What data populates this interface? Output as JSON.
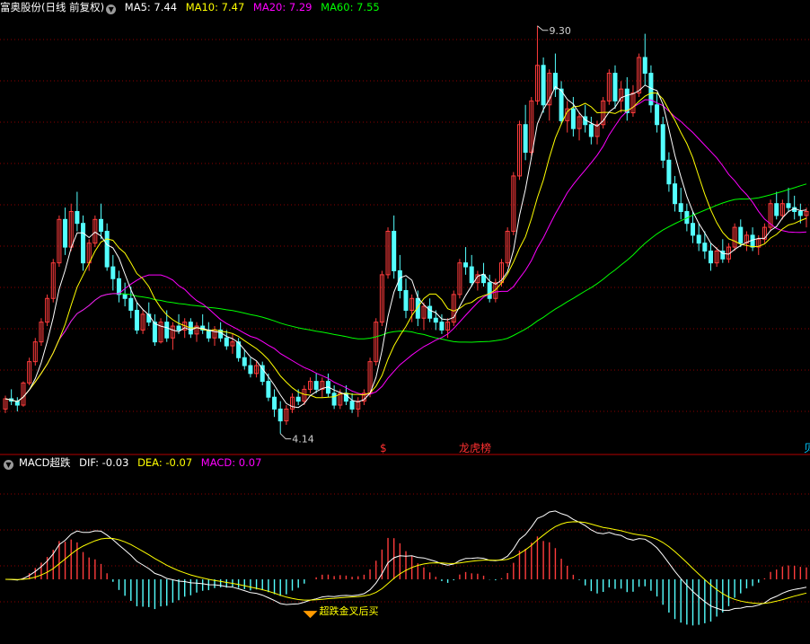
{
  "main_panel": {
    "title": "富奥股份(日线 前复权)",
    "indicators": [
      {
        "label": "MA5: 7.44",
        "color": "#ffffff"
      },
      {
        "label": "MA10: 7.47",
        "color": "#ffff00"
      },
      {
        "label": "MA20: 7.29",
        "color": "#ff00ff"
      },
      {
        "label": "MA60: 7.55",
        "color": "#00ff00"
      }
    ],
    "high_label": "9.30",
    "low_label": "4.14",
    "markers": [
      {
        "text": "$",
        "color": "#ff3030"
      },
      {
        "text": "龙虎榜",
        "color": "#ff3030"
      },
      {
        "text": "贝",
        "color": "#00c8ff"
      }
    ]
  },
  "macd_panel": {
    "title": "MACD超跌",
    "indicators": [
      {
        "label": "DIF: -0.03",
        "color": "#ffffff"
      },
      {
        "label": "DEA: -0.07",
        "color": "#ffff00"
      },
      {
        "label": "MACD: 0.07",
        "color": "#ff00ff"
      }
    ],
    "signal_text": "超跌金叉后买"
  },
  "colors": {
    "up": "#ff3c3c",
    "down": "#54ffff",
    "grid": "#8c0000",
    "divider": "#b40000",
    "signal": "#ffff00",
    "signal_marker": "#ff9a00"
  },
  "chart_data": {
    "type": "candlestick",
    "title": "富奥股份(日线 前复权)",
    "ohlc_approx": [
      [
        4.45,
        4.62,
        4.4,
        4.58
      ],
      [
        4.58,
        4.7,
        4.5,
        4.55
      ],
      [
        4.55,
        4.6,
        4.42,
        4.5
      ],
      [
        4.5,
        4.8,
        4.48,
        4.78
      ],
      [
        4.78,
        5.1,
        4.75,
        5.05
      ],
      [
        5.05,
        5.35,
        5.0,
        5.3
      ],
      [
        5.3,
        5.6,
        5.25,
        5.55
      ],
      [
        5.55,
        5.9,
        5.5,
        5.85
      ],
      [
        5.85,
        6.35,
        5.8,
        6.3
      ],
      [
        6.3,
        6.9,
        6.25,
        6.85
      ],
      [
        6.85,
        7.0,
        6.4,
        6.5
      ],
      [
        6.5,
        7.05,
        6.45,
        6.95
      ],
      [
        6.95,
        7.2,
        6.7,
        6.8
      ],
      [
        6.8,
        6.9,
        6.2,
        6.3
      ],
      [
        6.3,
        6.6,
        6.2,
        6.55
      ],
      [
        6.55,
        6.9,
        6.5,
        6.85
      ],
      [
        6.85,
        7.05,
        6.6,
        6.7
      ],
      [
        6.7,
        6.8,
        6.2,
        6.25
      ],
      [
        6.25,
        6.4,
        5.95,
        6.1
      ],
      [
        6.1,
        6.2,
        5.8,
        5.9
      ],
      [
        5.9,
        6.05,
        5.75,
        5.85
      ],
      [
        5.85,
        6.0,
        5.6,
        5.7
      ],
      [
        5.7,
        5.8,
        5.4,
        5.45
      ],
      [
        5.45,
        5.7,
        5.4,
        5.65
      ],
      [
        5.65,
        5.8,
        5.5,
        5.55
      ],
      [
        5.55,
        5.65,
        5.25,
        5.3
      ],
      [
        5.3,
        5.6,
        5.28,
        5.55
      ],
      [
        5.55,
        5.7,
        5.3,
        5.35
      ],
      [
        5.35,
        5.55,
        5.2,
        5.5
      ],
      [
        5.5,
        5.65,
        5.4,
        5.45
      ],
      [
        5.45,
        5.6,
        5.35,
        5.55
      ],
      [
        5.55,
        5.6,
        5.35,
        5.4
      ],
      [
        5.4,
        5.55,
        5.3,
        5.5
      ],
      [
        5.5,
        5.65,
        5.4,
        5.45
      ],
      [
        5.45,
        5.55,
        5.3,
        5.35
      ],
      [
        5.35,
        5.5,
        5.25,
        5.45
      ],
      [
        5.45,
        5.55,
        5.3,
        5.35
      ],
      [
        5.35,
        5.45,
        5.2,
        5.25
      ],
      [
        5.25,
        5.4,
        5.15,
        5.3
      ],
      [
        5.3,
        5.35,
        5.05,
        5.1
      ],
      [
        5.1,
        5.2,
        4.95,
        5.0
      ],
      [
        5.0,
        5.1,
        4.85,
        4.9
      ],
      [
        4.9,
        5.05,
        4.85,
        5.0
      ],
      [
        5.0,
        5.05,
        4.75,
        4.8
      ],
      [
        4.8,
        4.9,
        4.55,
        4.6
      ],
      [
        4.6,
        4.7,
        4.35,
        4.45
      ],
      [
        4.45,
        4.55,
        4.14,
        4.3
      ],
      [
        4.3,
        4.5,
        4.25,
        4.45
      ],
      [
        4.45,
        4.65,
        4.4,
        4.6
      ],
      [
        4.6,
        4.7,
        4.5,
        4.55
      ],
      [
        4.55,
        4.75,
        4.5,
        4.7
      ],
      [
        4.7,
        4.85,
        4.65,
        4.8
      ],
      [
        4.8,
        4.9,
        4.65,
        4.7
      ],
      [
        4.7,
        4.85,
        4.6,
        4.8
      ],
      [
        4.8,
        4.9,
        4.6,
        4.65
      ],
      [
        4.65,
        4.75,
        4.45,
        4.5
      ],
      [
        4.5,
        4.7,
        4.45,
        4.65
      ],
      [
        4.65,
        4.75,
        4.5,
        4.55
      ],
      [
        4.55,
        4.65,
        4.4,
        4.45
      ],
      [
        4.45,
        4.6,
        4.35,
        4.55
      ],
      [
        4.55,
        4.7,
        4.5,
        4.65
      ],
      [
        4.65,
        5.1,
        4.6,
        5.05
      ],
      [
        5.05,
        5.6,
        5.0,
        5.55
      ],
      [
        5.55,
        6.2,
        5.5,
        6.15
      ],
      [
        6.15,
        6.75,
        6.1,
        6.7
      ],
      [
        6.7,
        6.9,
        6.1,
        6.2
      ],
      [
        6.2,
        6.4,
        5.85,
        5.95
      ],
      [
        5.95,
        6.1,
        5.6,
        5.7
      ],
      [
        5.7,
        5.9,
        5.55,
        5.85
      ],
      [
        5.85,
        5.95,
        5.5,
        5.6
      ],
      [
        5.6,
        5.8,
        5.45,
        5.75
      ],
      [
        5.75,
        5.85,
        5.55,
        5.6
      ],
      [
        5.6,
        5.7,
        5.45,
        5.55
      ],
      [
        5.55,
        5.65,
        5.4,
        5.45
      ],
      [
        5.45,
        5.6,
        5.35,
        5.55
      ],
      [
        5.55,
        5.95,
        5.5,
        5.9
      ],
      [
        5.9,
        6.35,
        5.85,
        6.3
      ],
      [
        6.3,
        6.5,
        6.15,
        6.25
      ],
      [
        6.25,
        6.4,
        6.0,
        6.05
      ],
      [
        6.05,
        6.2,
        5.95,
        6.15
      ],
      [
        6.15,
        6.3,
        6.0,
        6.05
      ],
      [
        6.05,
        6.15,
        5.8,
        5.85
      ],
      [
        5.85,
        6.1,
        5.8,
        6.05
      ],
      [
        6.05,
        6.35,
        6.0,
        6.3
      ],
      [
        6.3,
        6.75,
        6.25,
        6.7
      ],
      [
        6.7,
        7.45,
        6.65,
        7.4
      ],
      [
        7.4,
        8.1,
        7.35,
        8.05
      ],
      [
        8.05,
        8.3,
        7.6,
        7.7
      ],
      [
        7.7,
        8.4,
        7.65,
        8.35
      ],
      [
        8.35,
        9.3,
        8.3,
        8.8
      ],
      [
        8.8,
        8.9,
        8.2,
        8.3
      ],
      [
        8.3,
        8.75,
        8.1,
        8.7
      ],
      [
        8.7,
        8.95,
        8.4,
        8.5
      ],
      [
        8.5,
        8.6,
        8.05,
        8.1
      ],
      [
        8.1,
        8.35,
        7.95,
        8.25
      ],
      [
        8.25,
        8.4,
        7.9,
        8.0
      ],
      [
        8.0,
        8.2,
        7.85,
        8.15
      ],
      [
        8.15,
        8.3,
        7.95,
        8.05
      ],
      [
        8.05,
        8.15,
        7.8,
        7.9
      ],
      [
        7.9,
        8.1,
        7.8,
        8.05
      ],
      [
        8.05,
        8.4,
        8.0,
        8.35
      ],
      [
        8.35,
        8.75,
        8.3,
        8.7
      ],
      [
        8.7,
        8.8,
        8.25,
        8.35
      ],
      [
        8.35,
        8.6,
        8.2,
        8.5
      ],
      [
        8.5,
        8.65,
        8.1,
        8.2
      ],
      [
        8.2,
        8.55,
        8.15,
        8.45
      ],
      [
        8.45,
        8.95,
        8.4,
        8.9
      ],
      [
        8.9,
        9.2,
        8.55,
        8.7
      ],
      [
        8.7,
        8.8,
        8.2,
        8.3
      ],
      [
        8.3,
        8.45,
        7.95,
        8.05
      ],
      [
        8.05,
        8.15,
        7.5,
        7.6
      ],
      [
        7.6,
        7.7,
        7.2,
        7.3
      ],
      [
        7.3,
        7.4,
        6.95,
        7.05
      ],
      [
        7.05,
        7.25,
        6.85,
        6.95
      ],
      [
        6.95,
        7.05,
        6.7,
        6.8
      ],
      [
        6.8,
        6.95,
        6.55,
        6.65
      ],
      [
        6.65,
        6.8,
        6.45,
        6.55
      ],
      [
        6.55,
        6.7,
        6.35,
        6.45
      ],
      [
        6.45,
        6.55,
        6.2,
        6.3
      ],
      [
        6.3,
        6.5,
        6.25,
        6.45
      ],
      [
        6.45,
        6.6,
        6.3,
        6.35
      ],
      [
        6.35,
        6.55,
        6.3,
        6.5
      ],
      [
        6.5,
        6.8,
        6.45,
        6.75
      ],
      [
        6.75,
        6.85,
        6.5,
        6.55
      ],
      [
        6.55,
        6.7,
        6.45,
        6.65
      ],
      [
        6.65,
        6.75,
        6.45,
        6.5
      ],
      [
        6.5,
        6.65,
        6.4,
        6.6
      ],
      [
        6.6,
        6.8,
        6.55,
        6.75
      ],
      [
        6.75,
        7.1,
        6.7,
        7.05
      ],
      [
        7.05,
        7.2,
        6.85,
        6.9
      ],
      [
        6.9,
        7.1,
        6.85,
        7.05
      ],
      [
        7.05,
        7.25,
        6.95,
        7.0
      ],
      [
        7.0,
        7.15,
        6.85,
        6.95
      ],
      [
        6.95,
        7.05,
        6.8,
        6.9
      ],
      [
        6.9,
        7.0,
        6.75,
        6.95
      ]
    ],
    "series_names": [
      "MA5",
      "MA10",
      "MA20",
      "MA60"
    ],
    "latest": {
      "MA5": 7.44,
      "MA10": 7.47,
      "MA20": 7.29,
      "MA60": 7.55
    },
    "macd_latest": {
      "DIF": -0.03,
      "DEA": -0.07,
      "MACD": 0.07
    }
  }
}
